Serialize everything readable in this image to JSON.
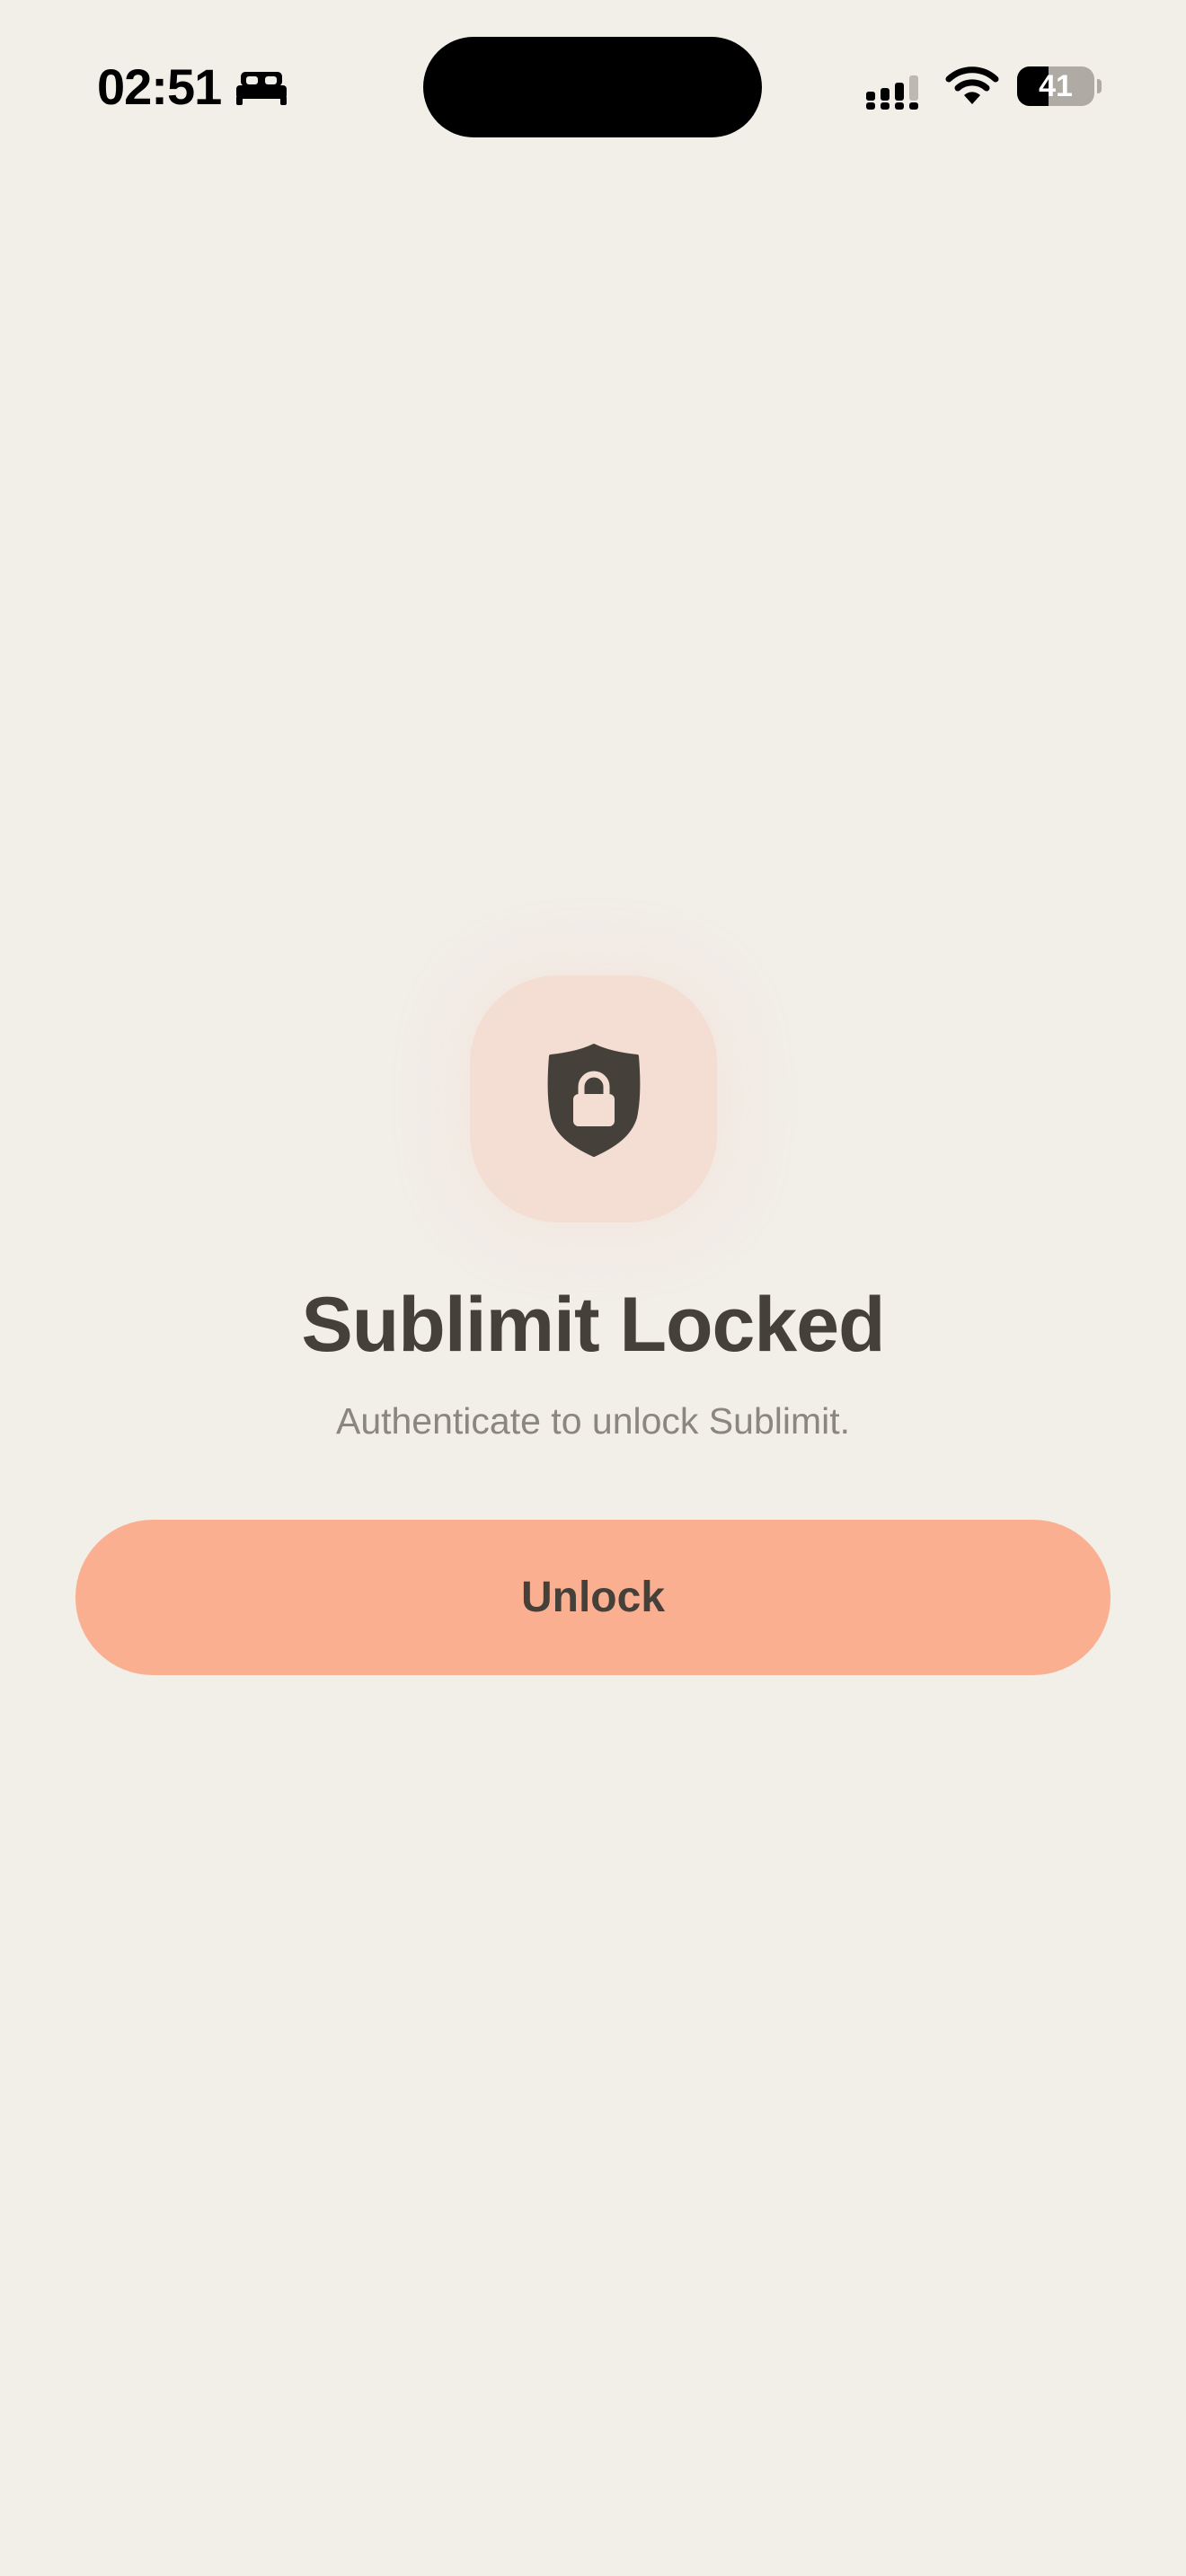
{
  "status_bar": {
    "time": "02:51",
    "focus_icon": "bed-icon",
    "signal_icon": "cellular-signal-icon",
    "wifi_icon": "wifi-icon",
    "battery_level": "41",
    "battery_fraction": 0.41
  },
  "lock_screen": {
    "icon": "shield-lock-icon",
    "title": "Sublimit Locked",
    "subtitle": "Authenticate to unlock Sublimit.",
    "unlock_label": "Unlock"
  },
  "colors": {
    "background": "#F2EEE8",
    "accent": "#FBAF91",
    "badge_background": "#F4DDD2",
    "text_primary": "#45413A",
    "text_secondary": "#8B867F"
  }
}
